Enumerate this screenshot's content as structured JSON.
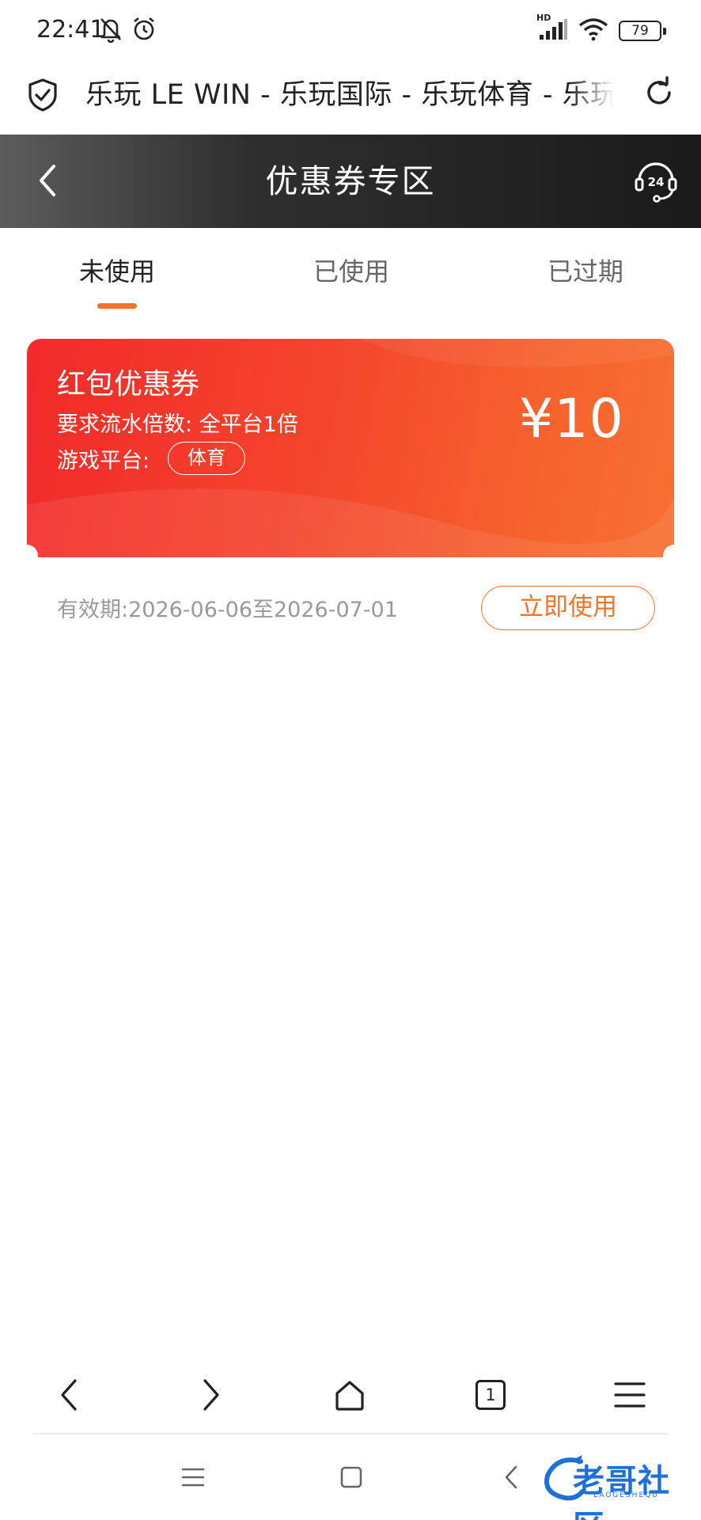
{
  "status_bar": {
    "time": "22:41",
    "network_badge": "HD",
    "battery_level": "79",
    "icons": [
      "bell-off-icon",
      "alarm-icon",
      "signal-icon",
      "wifi-icon",
      "battery-icon"
    ]
  },
  "browser": {
    "page_title": "乐玩 LE WIN - 乐玩国际 - 乐玩体育 - 乐玩",
    "icons": [
      "shield-check-icon",
      "refresh-icon"
    ]
  },
  "header": {
    "title": "优惠券专区",
    "support_badge": "24"
  },
  "tabs": [
    {
      "label": "未使用",
      "active": true
    },
    {
      "label": "已使用",
      "active": false
    },
    {
      "label": "已过期",
      "active": false
    }
  ],
  "coupon": {
    "title": "红包优惠券",
    "requirement": "要求流水倍数: 全平台1倍",
    "platform_label": "游戏平台:",
    "platform_tag": "体育",
    "amount": "¥10",
    "validity": "有效期:2026-06-06至2026-07-01",
    "use_button": "立即使用"
  },
  "browser_toolbar": {
    "tab_count": "1",
    "icons": [
      "back-arrow-icon",
      "forward-arrow-icon",
      "home-icon",
      "tabs-icon",
      "menu-icon"
    ]
  },
  "watermark": {
    "text": "老哥社区",
    "subtext": "LAOGESHEQU"
  },
  "colors": {
    "accent_orange": "#f0742a",
    "coupon_gradient_start": "#f22a2a",
    "coupon_gradient_end": "#f87032",
    "header_dark": "#1a1a1a"
  }
}
